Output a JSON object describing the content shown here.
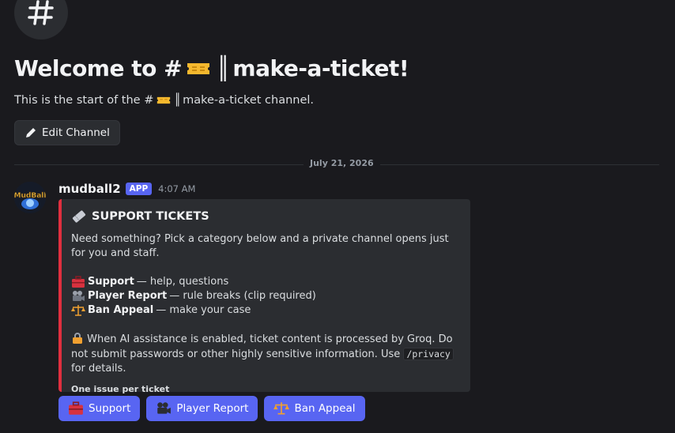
{
  "header": {
    "channel_icon": "hash-icon",
    "welcome_prefix": "Welcome to #",
    "channel_name": "make-a-ticket!",
    "start_prefix": "This is the start of the #",
    "start_suffix": "make-a-ticket channel.",
    "edit_label": "Edit Channel"
  },
  "divider": {
    "date": "July 21, 2026"
  },
  "message": {
    "username": "mudball2",
    "badge": "APP",
    "time": "4:07 AM",
    "avatar_icon": "mudball-logo",
    "avatar_text": "MudBall"
  },
  "embed": {
    "accent_color": "#e02f3f",
    "title": "SUPPORT TICKETS",
    "intro": "Need something? Pick a category below and a private channel opens just for you and staff.",
    "categories": [
      {
        "icon": "toolbox-icon",
        "name": "Support",
        "desc": "— help, questions"
      },
      {
        "icon": "movie-camera-icon",
        "name": "Player Report",
        "desc": "— rule breaks (clip required)"
      },
      {
        "icon": "scales-icon",
        "name": "Ban Appeal",
        "desc": "— make your case"
      }
    ],
    "notice_pre": "When AI assistance is enabled, ticket content is processed by Groq. Do not submit passwords or other highly sensitive information. Use",
    "notice_code": "/privacy",
    "notice_post": "for details.",
    "footer": "One issue per ticket"
  },
  "buttons": [
    {
      "icon": "toolbox-icon",
      "label": "Support"
    },
    {
      "icon": "movie-camera-icon",
      "label": "Player Report"
    },
    {
      "icon": "scales-icon",
      "label": "Ban Appeal"
    }
  ],
  "colors": {
    "background": "#1a1a1e",
    "brand": "#5865f2"
  }
}
